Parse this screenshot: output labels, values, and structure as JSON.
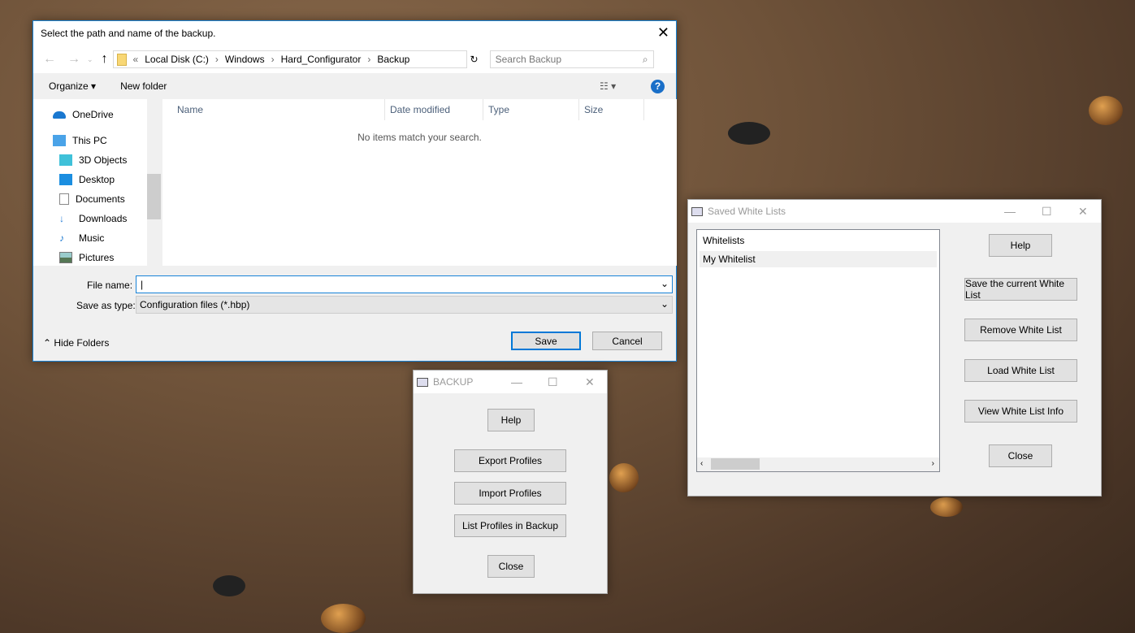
{
  "file_dialog": {
    "title": "Select the path and name of the backup.",
    "breadcrumb": [
      "Local Disk (C:)",
      "Windows",
      "Hard_Configurator",
      "Backup"
    ],
    "search_placeholder": "Search Backup",
    "organize": "Organize",
    "new_folder": "New folder",
    "nav": [
      {
        "label": "OneDrive",
        "icon": "onedrive-icon"
      },
      {
        "label": "This PC",
        "icon": "pc-icon"
      },
      {
        "label": "3D Objects",
        "icon": "cube-icon"
      },
      {
        "label": "Desktop",
        "icon": "desktop-icon"
      },
      {
        "label": "Documents",
        "icon": "documents-icon"
      },
      {
        "label": "Downloads",
        "icon": "download-icon"
      },
      {
        "label": "Music",
        "icon": "music-icon"
      },
      {
        "label": "Pictures",
        "icon": "pictures-icon"
      }
    ],
    "columns": [
      "Name",
      "Date modified",
      "Type",
      "Size"
    ],
    "empty": "No items match your search.",
    "file_name_label": "File name:",
    "file_name_value": "",
    "save_type_label": "Save as type:",
    "save_type_value": "Configuration files (*.hbp)",
    "save": "Save",
    "cancel": "Cancel",
    "hide_folders": "Hide Folders"
  },
  "backup": {
    "title": "BACKUP",
    "buttons": [
      "Help",
      "Export Profiles",
      "Import Profiles",
      "List Profiles in Backup",
      "Close"
    ]
  },
  "whitelists": {
    "title": "Saved White Lists",
    "list_header": "Whitelists",
    "items": [
      "My Whitelist"
    ],
    "buttons": [
      "Help",
      "Save the current White List",
      "Remove White List",
      "Load White List",
      "View White List Info",
      "Close"
    ]
  }
}
